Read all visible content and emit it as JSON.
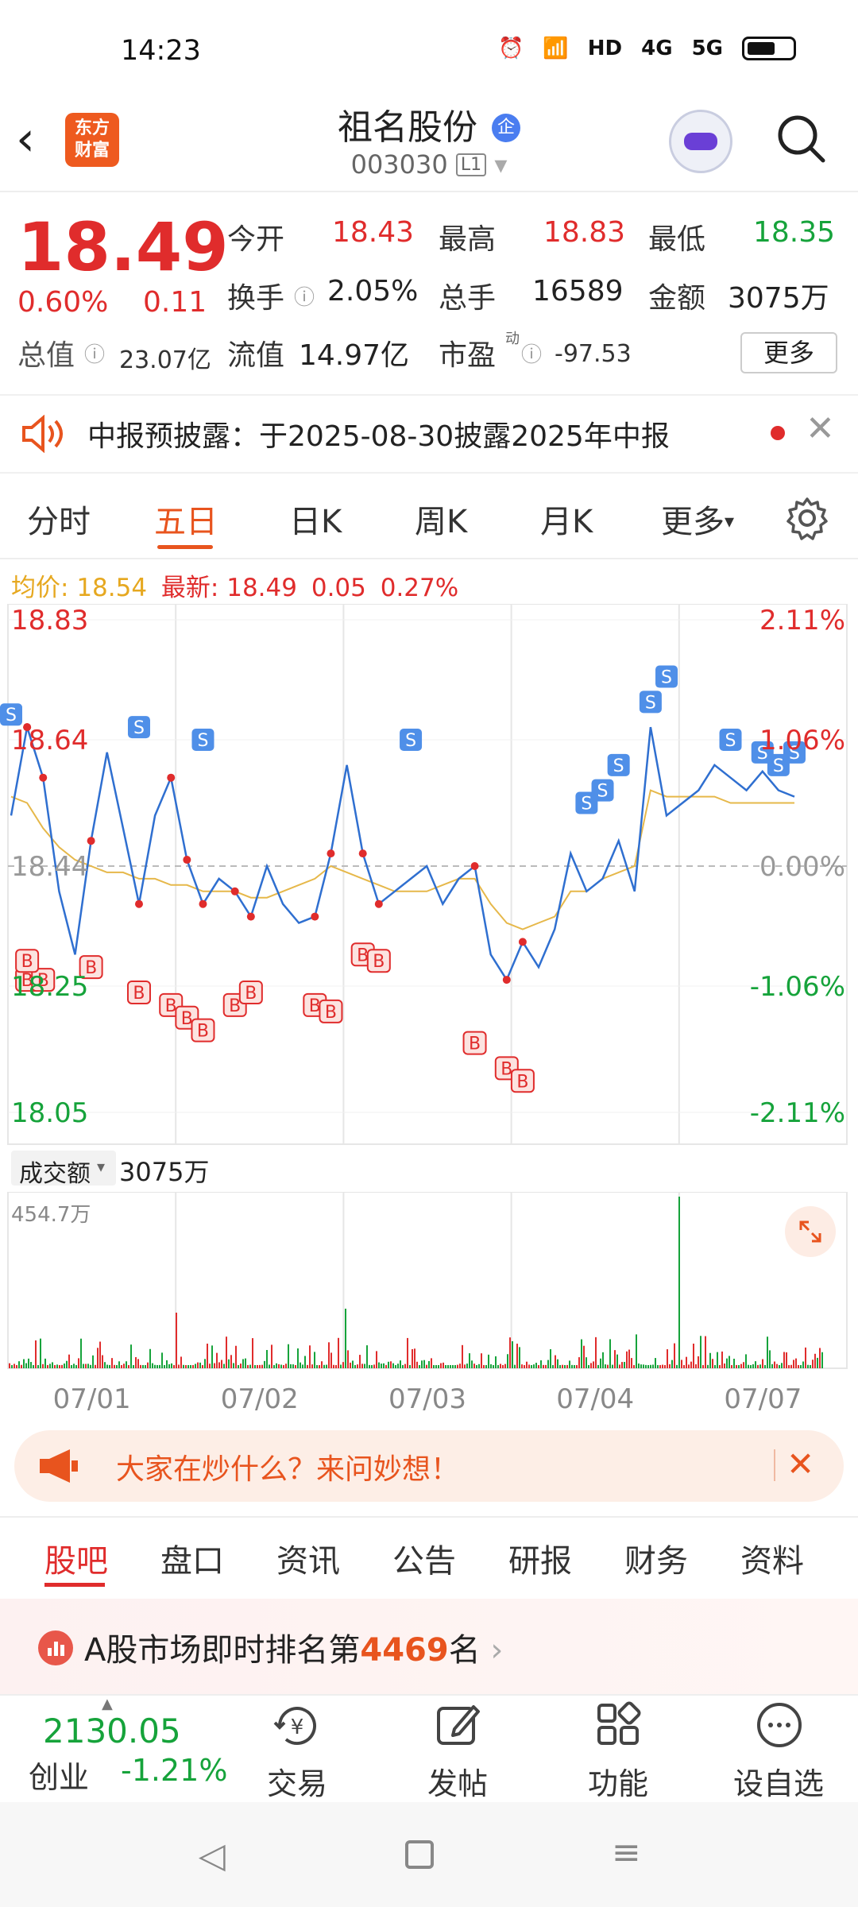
{
  "status": {
    "time": "14:23",
    "hd": "HD",
    "net1": "4G",
    "net2": "5G"
  },
  "header": {
    "back_glyph": "‹",
    "logo_line1": "东方",
    "logo_line2": "财富",
    "stock_name": "祖名股份",
    "badge": "企",
    "stock_code": "003030",
    "level": "L1"
  },
  "quote": {
    "price": "18.49",
    "change_pct": "0.60%",
    "change": "0.11",
    "open_label": "今开",
    "open": "18.43",
    "high_label": "最高",
    "high": "18.83",
    "low_label": "最低",
    "low": "18.35",
    "turnover_label": "换手",
    "turnover": "2.05%",
    "volume_label": "总手",
    "volume": "16589",
    "amount_label": "金额",
    "amount": "3075万",
    "mktcap_label": "总值",
    "mktcap": "23.07亿",
    "float_label": "流值",
    "float_cap": "14.97亿",
    "pe_label": "市盈",
    "pe_sup": "动",
    "pe": "-97.53",
    "more_label": "更多"
  },
  "notice": {
    "text": "中报预披露：于2025-08-30披露2025年中报"
  },
  "chart_tabs": [
    "分时",
    "五日",
    "日K",
    "周K",
    "月K",
    "更多"
  ],
  "avg_line": {
    "avg_label": "均价:",
    "avg": "18.54",
    "latest_label": "最新:",
    "latest": "18.49",
    "chg": "0.05",
    "chg_pct": "0.27%"
  },
  "chart_data": {
    "type": "line",
    "title": "",
    "x": [
      "07/01",
      "07/02",
      "07/03",
      "07/04",
      "07/07"
    ],
    "y_ticks_left": [
      "18.83",
      "18.64",
      "18.44",
      "18.25",
      "18.05"
    ],
    "y_ticks_right": [
      "2.11%",
      "1.06%",
      "0.00%",
      "-1.06%",
      "-2.11%"
    ],
    "ylim": [
      18.05,
      18.83
    ],
    "prev_close": 18.44,
    "series": [
      {
        "values": [
          18.52,
          18.66,
          18.58,
          18.4,
          18.3,
          18.48,
          18.62,
          18.5,
          18.38,
          18.52,
          18.58,
          18.45,
          18.38,
          18.42,
          18.4,
          18.36,
          18.44,
          18.38,
          18.35,
          18.36,
          18.46,
          18.6,
          18.46,
          18.38,
          18.4,
          18.42,
          18.44,
          18.38,
          18.42,
          18.44,
          18.3,
          18.26,
          18.32,
          18.28,
          18.34,
          18.46,
          18.4,
          18.42,
          18.48,
          18.4,
          18.66,
          18.52,
          18.54,
          18.56,
          18.6,
          18.58,
          18.56,
          18.59,
          18.56,
          18.55
        ]
      },
      {
        "values": [
          18.55,
          18.54,
          18.5,
          18.47,
          18.45,
          18.44,
          18.43,
          18.43,
          18.42,
          18.42,
          18.41,
          18.41,
          18.4,
          18.4,
          18.4,
          18.39,
          18.39,
          18.4,
          18.41,
          18.42,
          18.44,
          18.43,
          18.42,
          18.41,
          18.4,
          18.4,
          18.4,
          18.41,
          18.42,
          18.42,
          18.38,
          18.35,
          18.34,
          18.35,
          18.36,
          18.4,
          18.4,
          18.42,
          18.43,
          18.44,
          18.56,
          18.55,
          18.55,
          18.55,
          18.55,
          18.54,
          18.54,
          18.54,
          18.54,
          18.54
        ]
      }
    ],
    "markers_s": [
      [
        0,
        18.68
      ],
      [
        8,
        18.66
      ],
      [
        12,
        18.64
      ],
      [
        25,
        18.64
      ],
      [
        38,
        18.6
      ],
      [
        45,
        18.64
      ],
      [
        47,
        18.62
      ],
      [
        48,
        18.6
      ],
      [
        49,
        18.62
      ],
      [
        40,
        18.7
      ],
      [
        41,
        18.74
      ],
      [
        36,
        18.54
      ],
      [
        37,
        18.56
      ]
    ],
    "markers_b": [
      [
        1,
        18.26
      ],
      [
        2,
        18.26
      ],
      [
        5,
        18.28
      ],
      [
        8,
        18.24
      ],
      [
        10,
        18.22
      ],
      [
        11,
        18.2
      ],
      [
        12,
        18.18
      ],
      [
        14,
        18.22
      ],
      [
        15,
        18.24
      ],
      [
        19,
        18.22
      ],
      [
        20,
        18.21
      ],
      [
        22,
        18.3
      ],
      [
        23,
        18.29
      ],
      [
        29,
        18.16
      ],
      [
        31,
        18.12
      ],
      [
        32,
        18.1
      ],
      [
        1,
        18.29
      ]
    ],
    "volume_label": "成交额",
    "volume_total": "3075万",
    "volume_max_label": "454.7万"
  },
  "ask": {
    "text": "大家在炒什么？来问妙想！"
  },
  "bottom_tabs": [
    "股吧",
    "盘口",
    "资讯",
    "公告",
    "研报",
    "财务",
    "资料"
  ],
  "rank": {
    "prefix": "A股市场即时排名第",
    "num": "4469",
    "suffix": "名"
  },
  "bottom_bar": {
    "index_value": "2130.05",
    "index_name": "创业",
    "index_chg": "-1.21%",
    "trade": "交易",
    "post": "发帖",
    "func": "功能",
    "watch": "设自选"
  },
  "colors": {
    "up": "#e02c2c",
    "down": "#16a33b",
    "accent": "#e8541e",
    "line": "#2f6fd0",
    "avg": "#e6b84a"
  }
}
